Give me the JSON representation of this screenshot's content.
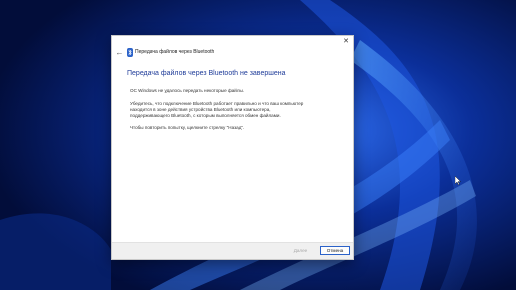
{
  "dialog": {
    "title": "Передача файлов через Bluetooth",
    "heading": "Передача файлов через Bluetooth не завершена",
    "paragraphs": [
      "ОС Windows не удалось передать некоторые файлы.",
      "Убедитесь, что подключение Bluetooth работает правильно и что ваш компьютер",
      "находится в зоне действия устройства Bluetooth или компьютера,",
      "поддерживающего Bluetooth, с которым выполняется обмен файлами.",
      "Чтобы повторить попытку, щелкните стрелку \"Назад\"."
    ],
    "buttons": {
      "next": "Далее",
      "cancel": "Отмена"
    },
    "icons": {
      "back": "back-arrow-icon",
      "bluetooth": "bluetooth-icon",
      "close": "close-icon"
    }
  },
  "colors": {
    "heading": "#1f3c99",
    "accent": "#2b62c9",
    "desktop_bg": "#04164d"
  }
}
